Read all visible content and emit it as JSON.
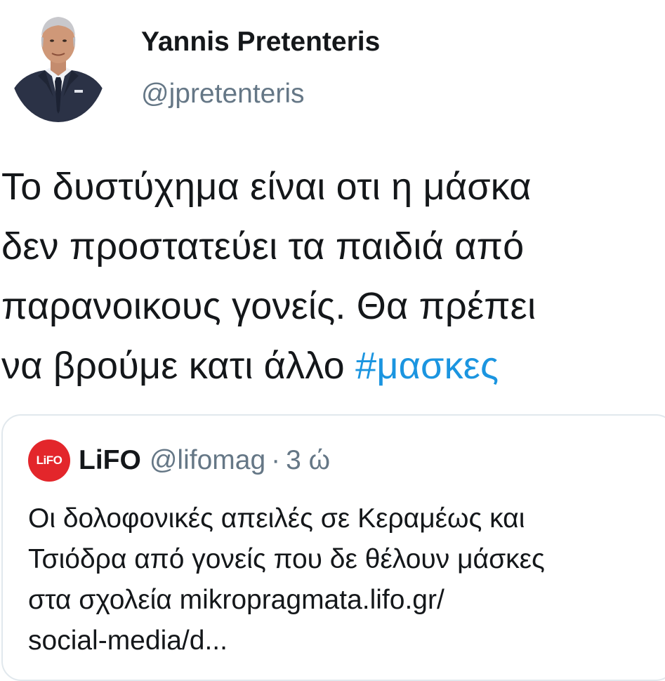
{
  "tweet": {
    "author": {
      "display_name": "Yannis Pretenteris",
      "handle": "@jpretenteris",
      "avatar_icon": "profile-photo"
    },
    "text_lines": [
      "Το δυστύχημα είναι οτι η μάσκα",
      "δεν προστατεύει τα παιδιά από",
      "παρανοικους γονείς. Θα πρέπει",
      "να βρούμε κατι άλλο "
    ],
    "hashtag": "#μασκες",
    "hashtag_color": "#1b95e0"
  },
  "quoted_tweet": {
    "logo_text": "LiFO",
    "logo_color": "#e3262b",
    "display_name": "LiFO",
    "handle": "@lifomag",
    "separator": "·",
    "time": "3 ώ",
    "text_lines": [
      "Οι δολοφονικές απειλές σε Κεραμέως και",
      "Τσιόδρα από γονείς που δε θέλουν μάσκες",
      "στα σχολεία mikropragmata.lifo.gr/",
      "social-media/d..."
    ]
  }
}
